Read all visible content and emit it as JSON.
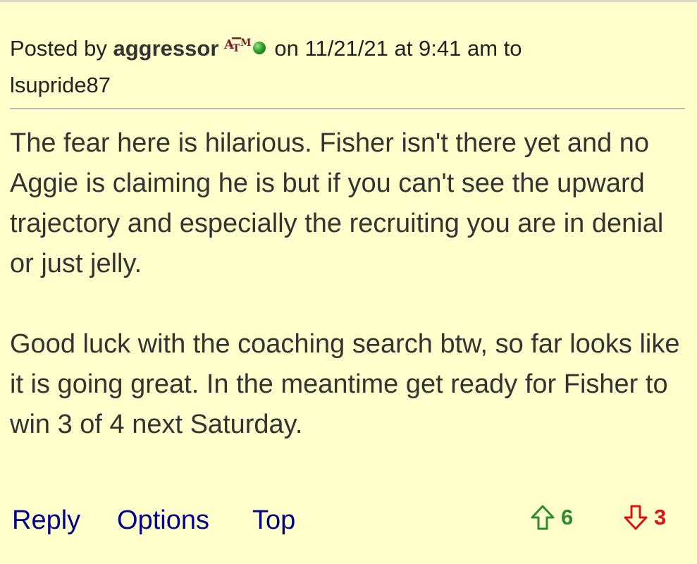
{
  "post": {
    "posted_by_label": "Posted by",
    "author": "aggressor",
    "team_logo_text": "ATM",
    "on_label": "on",
    "date": "11/21/21",
    "at_label": "at",
    "time": "9:41 am",
    "to_label": "to",
    "reply_to_user": "lsupride87",
    "body_paragraphs": [
      "The fear here is hilarious. Fisher isn't there yet and no Aggie is claiming he is but if you can't see the upward trajectory and especially the recruiting you are in denial or just jelly.",
      "Good luck with the coaching search btw, so far looks like it is going great. In the meantime get ready for Fisher to win 3 of 4 next Saturday."
    ]
  },
  "actions": {
    "reply_label": "Reply",
    "options_label": "Options",
    "top_label": "Top"
  },
  "votes": {
    "up_count": "6",
    "down_count": "3",
    "up_icon": "arrow-up-outline-icon",
    "down_icon": "arrow-down-outline-icon"
  },
  "colors": {
    "background": "#ffffcc",
    "link": "#000088",
    "upvote": "#2e8b2e",
    "downvote": "#dd1111",
    "team_logo": "#7a1d2c",
    "online_indicator": "#2fa02a"
  }
}
